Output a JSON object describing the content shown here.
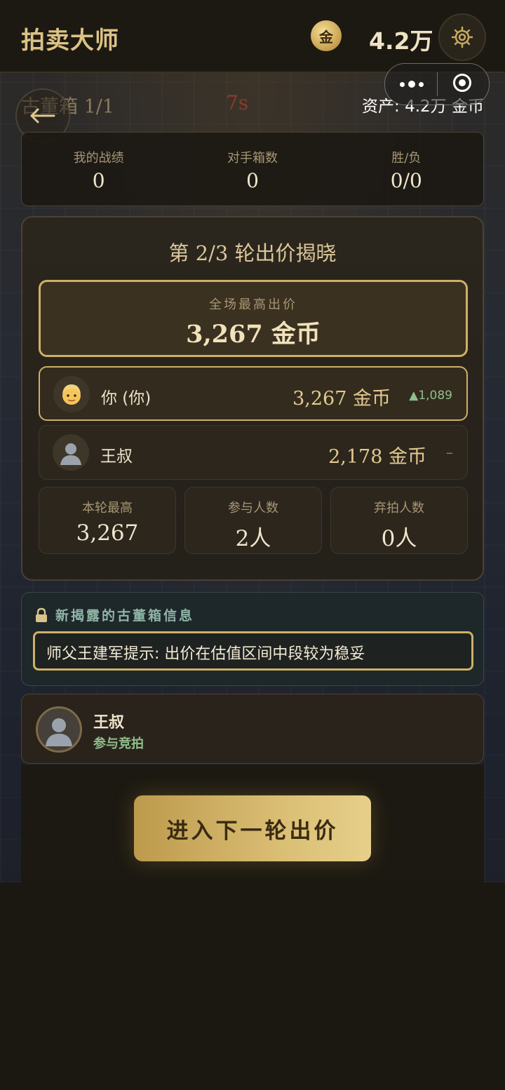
{
  "header": {
    "app_title": "拍卖大师",
    "coin_symbol": "金",
    "balance": "4.2万"
  },
  "status": {
    "box_progress": "古董箱 1/1",
    "timer": "7s",
    "assets": "资产: 4.2万 金币"
  },
  "stats": [
    {
      "label": "我的战绩",
      "value": "0"
    },
    {
      "label": "对手箱数",
      "value": "0"
    },
    {
      "label": "胜/负",
      "value": "0/0"
    }
  ],
  "reveal": {
    "title": "第 2/3 轮出价揭晓",
    "highest_label": "全场最高出价",
    "highest_value": "3,267 金币",
    "bidders": [
      {
        "name": "你 (你)",
        "amount": "3,267 金币",
        "delta": "▲1,089"
      },
      {
        "name": "王叔",
        "amount": "2,178 金币",
        "delta": "–"
      }
    ],
    "metrics": [
      {
        "label": "本轮最高",
        "value": "3,267"
      },
      {
        "label": "参与人数",
        "value": "2人"
      },
      {
        "label": "弃拍人数",
        "value": "0人"
      }
    ]
  },
  "info": {
    "title": "新揭露的古董箱信息",
    "hint": "师父王建军提示: 出价在估值区间中段较为稳妥"
  },
  "opponent": {
    "name": "王叔",
    "status": "参与竞拍"
  },
  "actions": {
    "next_round": "进入下一轮出价"
  },
  "colors": {
    "gold": "#cdb068",
    "gold_text": "#dcc285",
    "green": "#8fbf8c",
    "timer_red": "#8c3a2e",
    "background": "#1b1812"
  },
  "icons": {
    "coin": "gold-coin-icon",
    "settings": "gear-icon",
    "back": "arrow-left-icon",
    "more": "more-dots-icon",
    "close_miniprogram": "target-circle-icon",
    "lock": "lock-icon",
    "user_avatar": "user-emoji-avatar",
    "opponent_avatar": "person-silhouette-icon"
  }
}
